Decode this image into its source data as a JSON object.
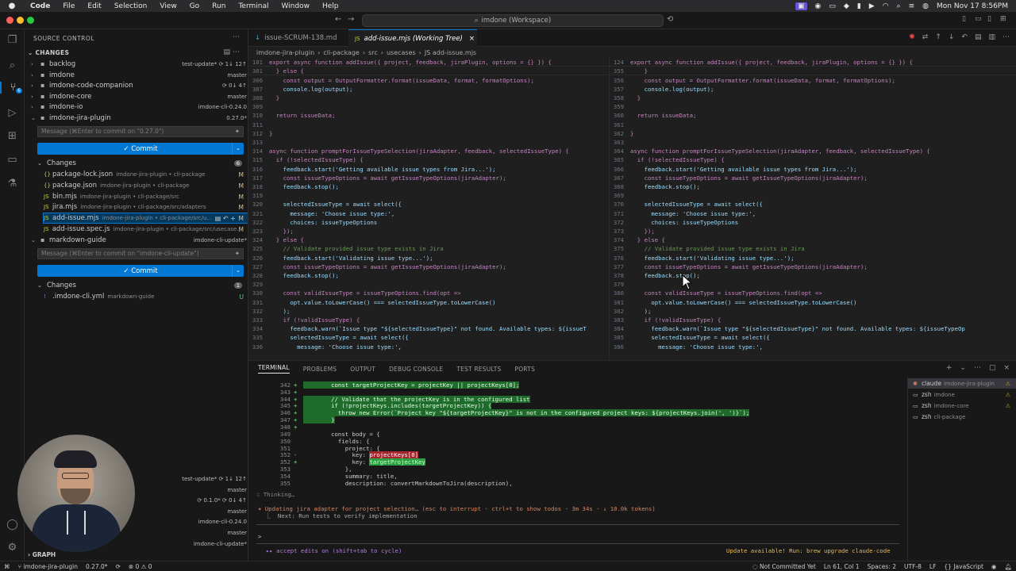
{
  "menubar": {
    "app": "Code",
    "items": [
      "File",
      "Edit",
      "Selection",
      "View",
      "Go",
      "Run",
      "Terminal",
      "Window",
      "Help"
    ],
    "datetime": "Mon Nov 17  8:56PM"
  },
  "titlebar": {
    "search": "imdone (Workspace)"
  },
  "sidebar": {
    "title": "SOURCE CONTROL",
    "section": "CHANGES",
    "repos": [
      {
        "name": "backlog",
        "status": "test-update*  ⟳ 1↓ 12↑"
      },
      {
        "name": "imdone",
        "status": "master"
      },
      {
        "name": "imdone-code-companion",
        "status": "⟳ 0↓ 4↑"
      },
      {
        "name": "imdone-core",
        "status": "master"
      },
      {
        "name": "imdone-io",
        "status": "imdone-cli-0.24.0"
      },
      {
        "name": "imdone-jira-plugin",
        "status": "0.27.0*"
      }
    ],
    "message_placeholder_1": "Message (⌘Enter to commit on \"0.27.0\")",
    "commit_label": "✓ Commit",
    "changes_label": "Changes",
    "changes_count": "6",
    "files": [
      {
        "name": "package-lock.json",
        "path": "imdone-jira-plugin • cli-package",
        "status": "M"
      },
      {
        "name": "package.json",
        "path": "imdone-jira-plugin • cli-package",
        "status": "M"
      },
      {
        "name": "bin.mjs",
        "path": "imdone-jira-plugin • cli-package/src",
        "status": "M"
      },
      {
        "name": "jira.mjs",
        "path": "imdone-jira-plugin • cli-package/src/adapters",
        "status": "M"
      },
      {
        "name": "add-issue.mjs",
        "path": "imdone-jira-plugin • cli-package/src/u...",
        "status": "M"
      },
      {
        "name": "add-issue.spec.js",
        "path": "imdone-jira-plugin • cli-package/src/usecase...",
        "status": "M"
      }
    ],
    "repo2": {
      "name": "markdown-guide",
      "status": "imdone-cli-update*"
    },
    "message_placeholder_2": "Message (⌘Enter to commit on \"imdone-cli-update\")",
    "changes_count_2": "1",
    "file2": {
      "name": ".imdone-cli.yml",
      "path": "markdown-guide",
      "status": "U"
    },
    "graph_statuses": [
      "test-update*  ⟳ 1↓ 12↑",
      "master",
      "⟳ 0.1.0*  ⟳ 0↓ 4↑",
      "master",
      "imdone-cli-0.24.0",
      "master",
      "imdone-cli-update*"
    ],
    "graph_label": "GRAPH"
  },
  "tabs": [
    {
      "label": "issue-SCRUM-138.md",
      "icon": "↓"
    },
    {
      "label": "add-issue.mjs (Working Tree)",
      "icon": "JS"
    }
  ],
  "breadcrumb": [
    "imdone-jira-plugin",
    "cli-package",
    "src",
    "usecases",
    "JS add-issue.mjs"
  ],
  "editor_left": [
    {
      "n": "101",
      "t": "export async function addIssue({ project, feedback, jiraPlugin, options = {} }) {"
    },
    {
      "n": "301",
      "t": "  } else {"
    },
    {
      "n": "306",
      "t": "    const output = OutputFormatter.format(issueData, format, formatOptions);"
    },
    {
      "n": "307",
      "t": "    console.log(output);"
    },
    {
      "n": "308",
      "t": "  }"
    },
    {
      "n": "309",
      "t": ""
    },
    {
      "n": "310",
      "t": "  return issueData;"
    },
    {
      "n": "311",
      "t": ""
    },
    {
      "n": "312",
      "t": "}"
    },
    {
      "n": "313",
      "t": ""
    },
    {
      "n": "314",
      "t": "async function promptForIssueTypeSelection(jiraAdapter, feedback, selectedIssueType) {"
    },
    {
      "n": "315",
      "t": "  if (!selectedIssueType) {"
    },
    {
      "n": "316",
      "t": "    feedback.start('Getting available issue types from Jira...');"
    },
    {
      "n": "317",
      "t": "    const issueTypeOptions = await getIssueTypeOptions(jiraAdapter);"
    },
    {
      "n": "318",
      "t": "    feedback.stop();"
    },
    {
      "n": "319",
      "t": ""
    },
    {
      "n": "320",
      "t": "    selectedIssueType = await select({"
    },
    {
      "n": "321",
      "t": "      message: 'Choose issue type:',"
    },
    {
      "n": "322",
      "t": "      choices: issueTypeOptions"
    },
    {
      "n": "323",
      "t": "    });"
    },
    {
      "n": "324",
      "t": "  } else {"
    },
    {
      "n": "325",
      "t": "    // Validate provided issue type exists in Jira"
    },
    {
      "n": "326",
      "t": "    feedback.start('Validating issue type...');"
    },
    {
      "n": "327",
      "t": "    const issueTypeOptions = await getIssueTypeOptions(jiraAdapter);"
    },
    {
      "n": "328",
      "t": "    feedback.stop();"
    },
    {
      "n": "329",
      "t": ""
    },
    {
      "n": "330",
      "t": "    const validIssueType = issueTypeOptions.find(opt =>"
    },
    {
      "n": "331",
      "t": "      opt.value.toLowerCase() === selectedIssueType.toLowerCase()"
    },
    {
      "n": "332",
      "t": "    );"
    },
    {
      "n": "333",
      "t": "    if (!validIssueType) {"
    },
    {
      "n": "334",
      "t": "      feedback.warn(`Issue type \"${selectedIssueType}\" not found. Available types: ${issueT"
    },
    {
      "n": "335",
      "t": "      selectedIssueType = await select({"
    },
    {
      "n": "336",
      "t": "        message: 'Choose issue type:',"
    }
  ],
  "editor_right": [
    {
      "n": "124",
      "t": "export async function addIssue({ project, feedback, jiraPlugin, options = {} }) {"
    },
    {
      "n": "355",
      "t": "    }"
    },
    {
      "n": "356",
      "t": "    const output = OutputFormatter.format(issueData, format, formatOptions);"
    },
    {
      "n": "357",
      "t": "    console.log(output);"
    },
    {
      "n": "358",
      "t": "  }"
    },
    {
      "n": "359",
      "t": ""
    },
    {
      "n": "360",
      "t": "  return issueData;"
    },
    {
      "n": "361",
      "t": ""
    },
    {
      "n": "362",
      "t": "}"
    },
    {
      "n": "363",
      "t": ""
    },
    {
      "n": "364",
      "t": "async function promptForIssueTypeSelection(jiraAdapter, feedback, selectedIssueType) {"
    },
    {
      "n": "365",
      "t": "  if (!selectedIssueType) {"
    },
    {
      "n": "366",
      "t": "    feedback.start('Getting available issue types from Jira...');"
    },
    {
      "n": "367",
      "t": "    const issueTypeOptions = await getIssueTypeOptions(jiraAdapter);"
    },
    {
      "n": "368",
      "t": "    feedback.stop();"
    },
    {
      "n": "369",
      "t": ""
    },
    {
      "n": "370",
      "t": "    selectedIssueType = await select({"
    },
    {
      "n": "371",
      "t": "      message: 'Choose issue type:',"
    },
    {
      "n": "372",
      "t": "      choices: issueTypeOptions"
    },
    {
      "n": "373",
      "t": "    });"
    },
    {
      "n": "374",
      "t": "  } else {"
    },
    {
      "n": "375",
      "t": "    // Validate provided issue type exists in Jira"
    },
    {
      "n": "376",
      "t": "    feedback.start('Validating issue type...');"
    },
    {
      "n": "377",
      "t": "    const issueTypeOptions = await getIssueTypeOptions(jiraAdapter);"
    },
    {
      "n": "378",
      "t": "    feedback.stop();"
    },
    {
      "n": "379",
      "t": ""
    },
    {
      "n": "380",
      "t": "    const validIssueType = issueTypeOptions.find(opt =>"
    },
    {
      "n": "381",
      "t": "      opt.value.toLowerCase() === selectedIssueType.toLowerCase()"
    },
    {
      "n": "382",
      "t": "    );"
    },
    {
      "n": "383",
      "t": "    if (!validIssueType) {"
    },
    {
      "n": "384",
      "t": "      feedback.warn(`Issue type \"${selectedIssueType}\" not found. Available types: ${issueTypeOp"
    },
    {
      "n": "385",
      "t": "      selectedIssueType = await select({"
    },
    {
      "n": "386",
      "t": "        message: 'Choose issue type:',"
    }
  ],
  "panel": {
    "tabs": [
      "TERMINAL",
      "PROBLEMS",
      "OUTPUT",
      "DEBUG CONSOLE",
      "TEST RESULTS",
      "PORTS"
    ],
    "diff": [
      {
        "n": "342",
        "m": "+",
        "t": "        const targetProjectKey = projectKey || projectKeys[0];",
        "k": "add"
      },
      {
        "n": "343",
        "m": "+",
        "t": "",
        "k": "add"
      },
      {
        "n": "344",
        "m": "+",
        "t": "        // Validate that the projectKey is in the configured list",
        "k": "add"
      },
      {
        "n": "345",
        "m": "+",
        "t": "        if (!projectKeys.includes(targetProjectKey)) {",
        "k": "add"
      },
      {
        "n": "346",
        "m": "+",
        "t": "          throw new Error(`Project key \"${targetProjectKey}\" is not in the configured project keys: ${projectKeys.join(', ')}`);",
        "k": "add"
      },
      {
        "n": "347",
        "m": "+",
        "t": "        }",
        "k": "add"
      },
      {
        "n": "348",
        "m": "+",
        "t": "",
        "k": "add"
      },
      {
        "n": "349",
        "m": "",
        "t": "        const body = {",
        "k": "ctx"
      },
      {
        "n": "350",
        "m": "",
        "t": "          fields: {",
        "k": "ctx"
      },
      {
        "n": "351",
        "m": "",
        "t": "            project: {",
        "k": "ctx"
      },
      {
        "n": "352",
        "m": "-",
        "t": "              key: ",
        "hl": "projectKeys[0]",
        "k": "del"
      },
      {
        "n": "352",
        "m": "+",
        "t": "              key: ",
        "hl": "targetProjectKey",
        "k": "add2"
      },
      {
        "n": "353",
        "m": "",
        "t": "            },",
        "k": "ctx"
      },
      {
        "n": "354",
        "m": "",
        "t": "            summary: title,",
        "k": "ctx"
      },
      {
        "n": "355",
        "m": "",
        "t": "            description: convertMarkdownToJira(description),",
        "k": "ctx"
      }
    ],
    "thinking": "∴ Thinking…",
    "status_line": "✶ Updating jira adapter for project selection… (esc to interrupt · ctrl+t to show todos · 3m 34s · ↓ 10.0k tokens)",
    "next_line": "  ⎿  Next: Run tests to verify implementation",
    "prompt": ">",
    "accept_edits": "▸▸ accept edits on (shift+tab to cycle)",
    "update_notice": "Update available! Run: brew upgrade claude-code",
    "terminals": [
      {
        "name": "claude",
        "sub": "imdone-jira-plugin",
        "warn": "⚠"
      },
      {
        "name": "zsh",
        "sub": "imdone",
        "warn": "⚠"
      },
      {
        "name": "zsh",
        "sub": "imdone-core",
        "warn": "⚠"
      },
      {
        "name": "zsh",
        "sub": "cli-package",
        "warn": ""
      }
    ]
  },
  "statusbar": {
    "branch": "imdone-jira-plugin",
    "version": "0.27.0*",
    "problems": "⊗ 0 ⚠ 0",
    "git": "Not Committed Yet",
    "position": "Ln 61, Col 1",
    "spaces": "Spaces: 2",
    "encoding": "UTF-8",
    "eol": "LF",
    "lang": "{} JavaScript"
  }
}
